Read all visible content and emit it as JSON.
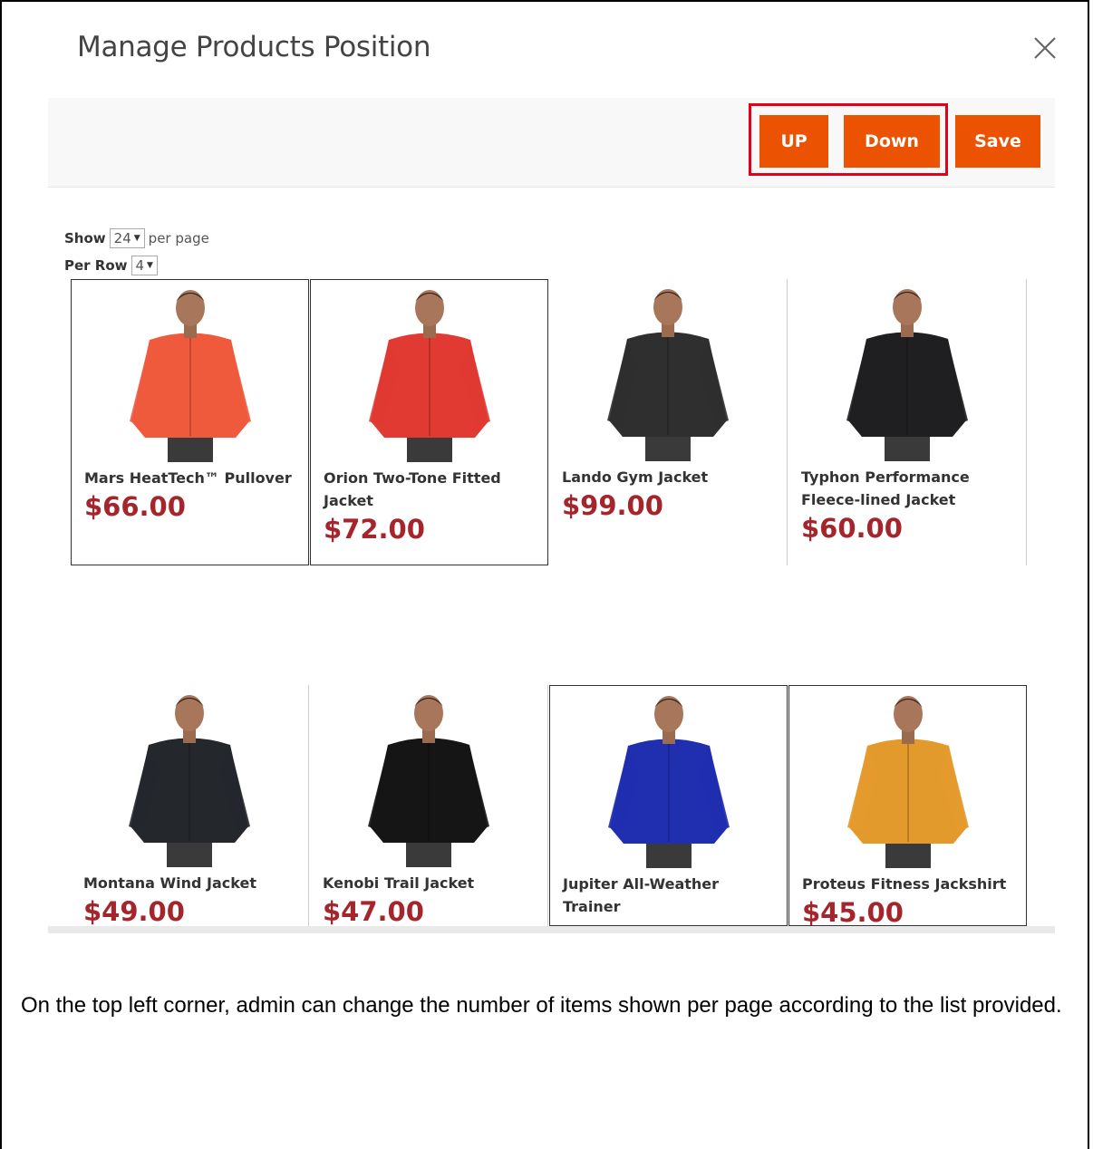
{
  "modal": {
    "title": "Manage Products Position",
    "close_icon": "close-icon"
  },
  "toolbar": {
    "up_label": "UP",
    "down_label": "Down",
    "save_label": "Save",
    "accent_color": "#eb5202",
    "highlight_color": "#e2001a"
  },
  "controls": {
    "show_label": "Show",
    "show_value": "24",
    "per_page_label": "per page",
    "per_row_label": "Per Row",
    "per_row_value": "4"
  },
  "products": [
    {
      "name": "Mars HeatTech™ Pullover",
      "price": "$66.00",
      "jacket_color": "#f05a3c"
    },
    {
      "name": "Orion Two-Tone Fitted Jacket",
      "price": "$72.00",
      "jacket_color": "#e03a32"
    },
    {
      "name": "Lando Gym Jacket",
      "price": "$99.00",
      "jacket_color": "#2f2f2f"
    },
    {
      "name": "Typhon Performance Fleece-lined Jacket",
      "price": "$60.00",
      "jacket_color": "#1f1f22"
    },
    {
      "name": "Montana Wind Jacket",
      "price": "$49.00",
      "jacket_color": "#24272c"
    },
    {
      "name": "Kenobi Trail Jacket",
      "price": "$47.00",
      "jacket_color": "#151515"
    },
    {
      "name": "Jupiter All-Weather Trainer",
      "price": "",
      "jacket_color": "#1f2fb0"
    },
    {
      "name": "Proteus Fitness Jackshirt",
      "price": "$45.00",
      "jacket_color": "#e39a2c"
    }
  ],
  "caption": "On the top left corner, admin can change the number of items shown per page according to the list provided."
}
